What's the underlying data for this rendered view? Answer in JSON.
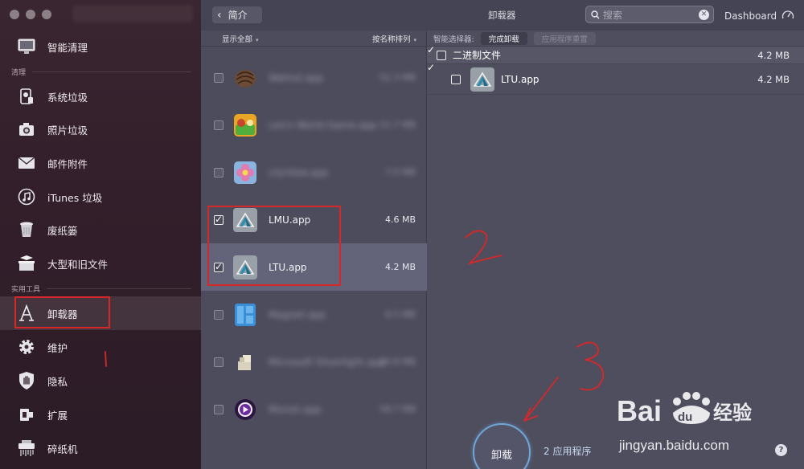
{
  "sidebar": {
    "items": [
      {
        "label": "智能清理",
        "icon": "monitor-icon"
      },
      {
        "label": "系统垃圾",
        "icon": "system-trash-icon"
      },
      {
        "label": "照片垃圾",
        "icon": "camera-icon"
      },
      {
        "label": "邮件附件",
        "icon": "mail-icon"
      },
      {
        "label": "iTunes 垃圾",
        "icon": "music-icon"
      },
      {
        "label": "废纸篓",
        "icon": "trash-icon"
      },
      {
        "label": "大型和旧文件",
        "icon": "box-icon"
      },
      {
        "label": "卸载器",
        "icon": "uninstaller-icon"
      },
      {
        "label": "维护",
        "icon": "gear-icon"
      },
      {
        "label": "隐私",
        "icon": "privacy-hand-icon"
      },
      {
        "label": "扩展",
        "icon": "extension-icon"
      },
      {
        "label": "碎纸机",
        "icon": "shredder-icon"
      }
    ],
    "sections": {
      "cleanup": "清理",
      "tools": "实用工具"
    }
  },
  "topbar": {
    "back_label": "简介",
    "title": "卸载器",
    "search_placeholder": "搜索",
    "dashboard_label": "Dashboard"
  },
  "applist": {
    "filter_label": "显示全部",
    "sort_label": "按名称排列",
    "rows": [
      {
        "name": "",
        "size": "",
        "checked": false,
        "blurred": true,
        "icon": "walnut-icon"
      },
      {
        "name": "",
        "size": "",
        "checked": false,
        "blurred": true,
        "icon": "game-icon"
      },
      {
        "name": "",
        "size": "",
        "checked": false,
        "blurred": true,
        "icon": "flower-icon"
      },
      {
        "name": "LMU.app",
        "size": "4.6 MB",
        "checked": true,
        "blurred": false,
        "icon": "autodesk-icon"
      },
      {
        "name": "LTU.app",
        "size": "4.2 MB",
        "checked": true,
        "blurred": false,
        "icon": "autodesk-icon"
      },
      {
        "name": "",
        "size": "",
        "checked": false,
        "blurred": true,
        "icon": "blue-app-icon"
      },
      {
        "name": "",
        "size": "",
        "checked": false,
        "blurred": true,
        "icon": "package-icon"
      },
      {
        "name": "",
        "size": "",
        "checked": false,
        "blurred": true,
        "icon": "media-player-icon"
      }
    ]
  },
  "detail": {
    "selector_label": "智能选择器:",
    "complete_uninstall": "完成卸载",
    "app_reset": "应用程序重置",
    "group_label": "二进制文件",
    "group_size": "4.2 MB",
    "file_name": "LTU.app",
    "file_size": "4.2 MB"
  },
  "bottom": {
    "uninstall_label": "卸载",
    "count_label": "2 应用程序",
    "help_label": "?"
  },
  "watermark": {
    "brand": "Bai du 经验",
    "url": "jingyan.baidu.com"
  },
  "colors": {
    "annotation": "#d62828",
    "accent": "#6fa6d8"
  }
}
